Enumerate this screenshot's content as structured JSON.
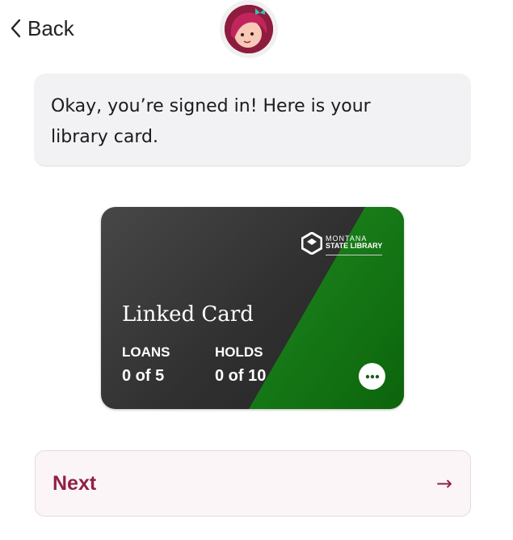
{
  "header": {
    "back_label": "Back",
    "avatar_icon": "libby-avatar-icon"
  },
  "message": {
    "text": "Okay, you’re signed in! Here is your library card."
  },
  "card": {
    "title": "Linked Card",
    "library_logo": {
      "line1": "MONTANA",
      "line2": "STATE LIBRARY"
    },
    "loans": {
      "label": "LOANS",
      "value": "0 of 5"
    },
    "holds": {
      "label": "HOLDS",
      "value": "0 of 10"
    },
    "more_icon": "ellipsis-icon",
    "colors": {
      "dark": "#333333",
      "green": "#1a7a1a"
    }
  },
  "next_button": {
    "label": "Next",
    "arrow": "→"
  },
  "colors": {
    "accent": "#8f2146",
    "bubble": "#f2f2f4"
  }
}
